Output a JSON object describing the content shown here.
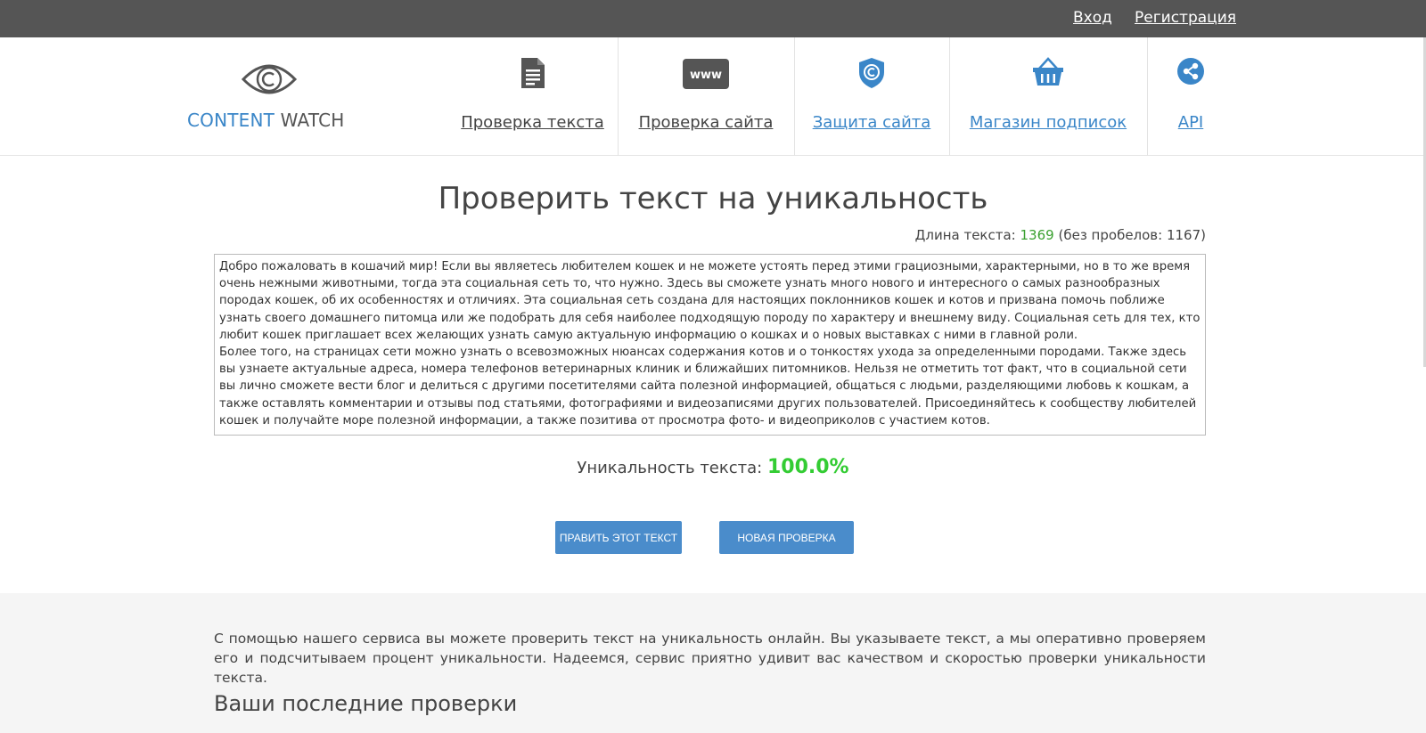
{
  "topbar": {
    "login": "Вход",
    "register": "Регистрация"
  },
  "logo": {
    "part1": "CONTENT",
    "part2": "WATCH"
  },
  "nav": [
    {
      "label": "Проверка текста",
      "icon": "document-icon"
    },
    {
      "label": "Проверка сайта",
      "icon": "www-icon"
    },
    {
      "label": "Защита сайта",
      "icon": "shield-copyright-icon"
    },
    {
      "label": "Магазин подписок",
      "icon": "basket-icon"
    },
    {
      "label": "API",
      "icon": "share-nodes-icon"
    }
  ],
  "page": {
    "title": "Проверить текст на уникальность",
    "length_label": "Длина текста:",
    "length_value": "1369",
    "length_nospace": "(без пробелов: 1167)",
    "text_p1": "Добро пожаловать в кошачий мир! Если вы являетесь любителем кошек и не можете устоять перед этими грациозными, характерными, но в то же время очень нежными животными, тогда эта социальная сеть то, что нужно. Здесь вы сможете узнать много нового и интересного о самых разнообразных породах кошек, об их особенностях и отличиях. Эта социальная сеть создана для настоящих поклонников кошек и котов и призвана помочь поближе узнать своего домашнего питомца или же подобрать для себя наиболее подходящую породу по характеру и внешнему виду. Социальная сеть для тех, кто любит кошек приглашает всех желающих узнать самую актуальную информацию о кошках и о новых выставках с ними в главной роли.",
    "text_p2": "Более того, на страницах сети можно узнать о всевозможных нюансах содержания котов и о тонкостях ухода за определенными породами. Также здесь вы узнаете актуальные адреса, номера телефонов ветеринарных клиник и ближайших питомников. Нельзя не отметить тот факт, что в социальной сети вы лично сможете вести блог и делиться с другими посетителями сайта полезной информацией, общаться с людьми, разделяющими любовь к кошкам, а также оставлять комментарии и отзывы под статьями, фотографиями и видеозаписями других пользователей. Присоединяйтесь к сообществу любителей кошек и получайте море полезной информации, а также позитива от просмотра фото- и видеоприколов с участием котов.",
    "uniqueness_label": "Уникальность текста:",
    "uniqueness_value": "100.0%",
    "btn_edit": "Править этот текст",
    "btn_new": "Новая проверка",
    "description": "С помощью нашего сервиса вы можете проверить текст на уникальность онлайн. Вы указываете текст, а мы оперативно проверяем его и подсчитываем процент уникальности. Надеемся, сервис приятно удивит вас качеством и скоростью проверки уникальности текста.",
    "recent_heading": "Ваши последние проверки"
  },
  "colors": {
    "topbar": "#555555",
    "accent": "#3a86c8",
    "button": "#4a8ccb",
    "length_number": "#3aa030",
    "uniqueness": "#33cc33",
    "footer_bg": "#f5f5f5"
  }
}
